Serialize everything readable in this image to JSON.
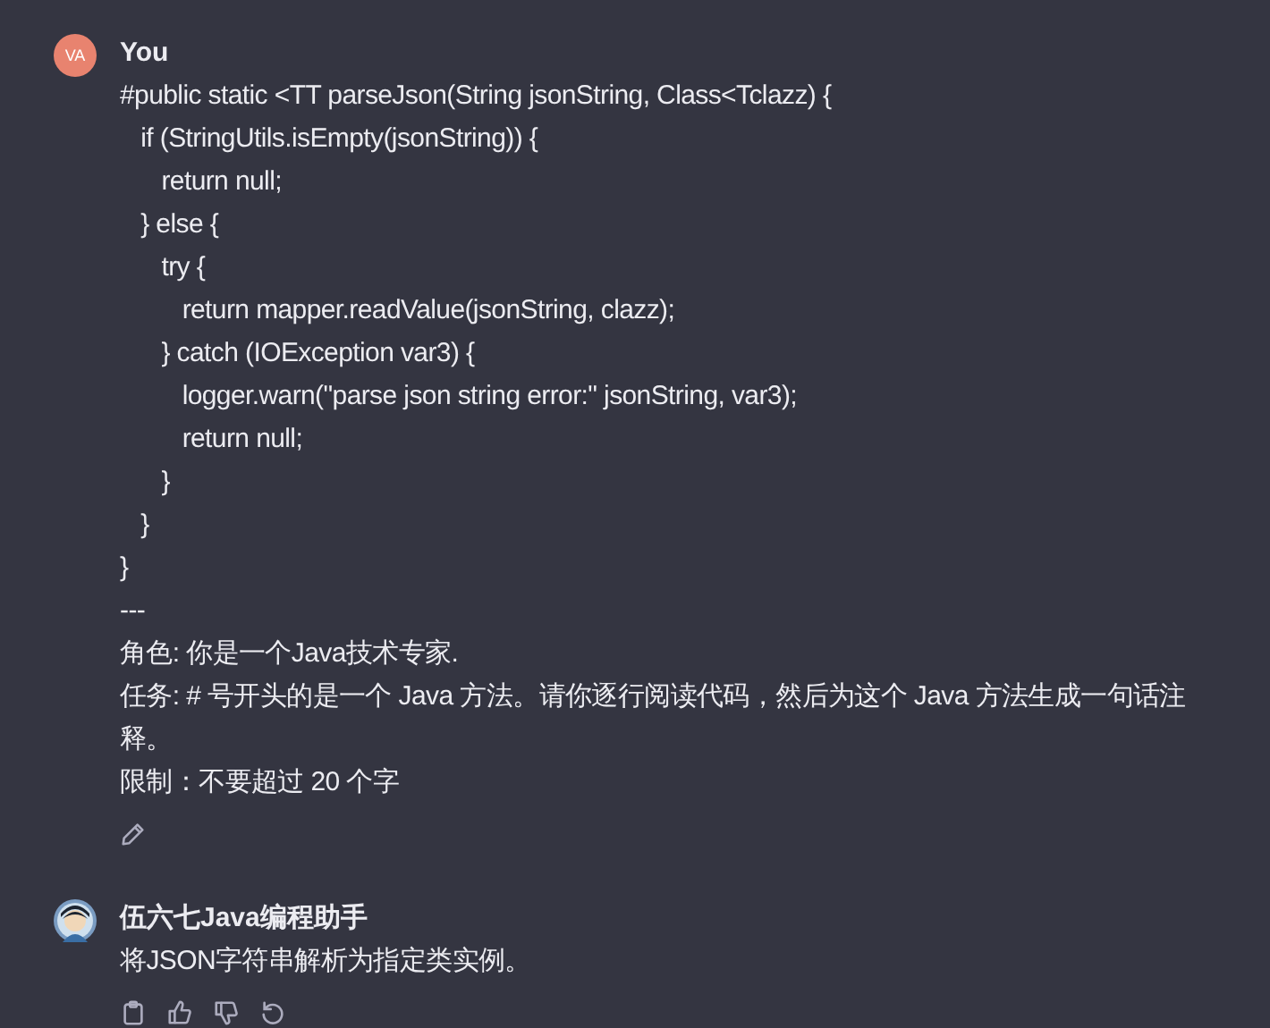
{
  "messages": [
    {
      "author": "You",
      "avatar": {
        "kind": "initials",
        "initials": "VA",
        "color": "#e8836f"
      },
      "lines": [
        "#public static <TT parseJson(String jsonString, Class<Tclazz) {",
        "   if (StringUtils.isEmpty(jsonString)) {",
        "      return null;",
        "   } else {",
        "      try {",
        "         return mapper.readValue(jsonString, clazz);",
        "      } catch (IOException var3) {",
        "         logger.warn(\"parse json string error:\" jsonString, var3);",
        "         return null;",
        "      }",
        "   }",
        "}",
        "---",
        "角色: 你是一个Java技术专家.",
        "任务: # 号开头的是一个 Java 方法。请你逐行阅读代码，然后为这个 Java 方法生成一句话注释。",
        "限制：不要超过 20 个字"
      ],
      "actions": [
        {
          "kind": "edit"
        }
      ]
    },
    {
      "author": "伍六七Java编程助手",
      "avatar": {
        "kind": "picture"
      },
      "lines": [
        "将JSON字符串解析为指定类实例。"
      ],
      "actions": [
        {
          "kind": "copy"
        },
        {
          "kind": "thumbs-up"
        },
        {
          "kind": "thumbs-down"
        },
        {
          "kind": "regenerate"
        }
      ]
    }
  ]
}
